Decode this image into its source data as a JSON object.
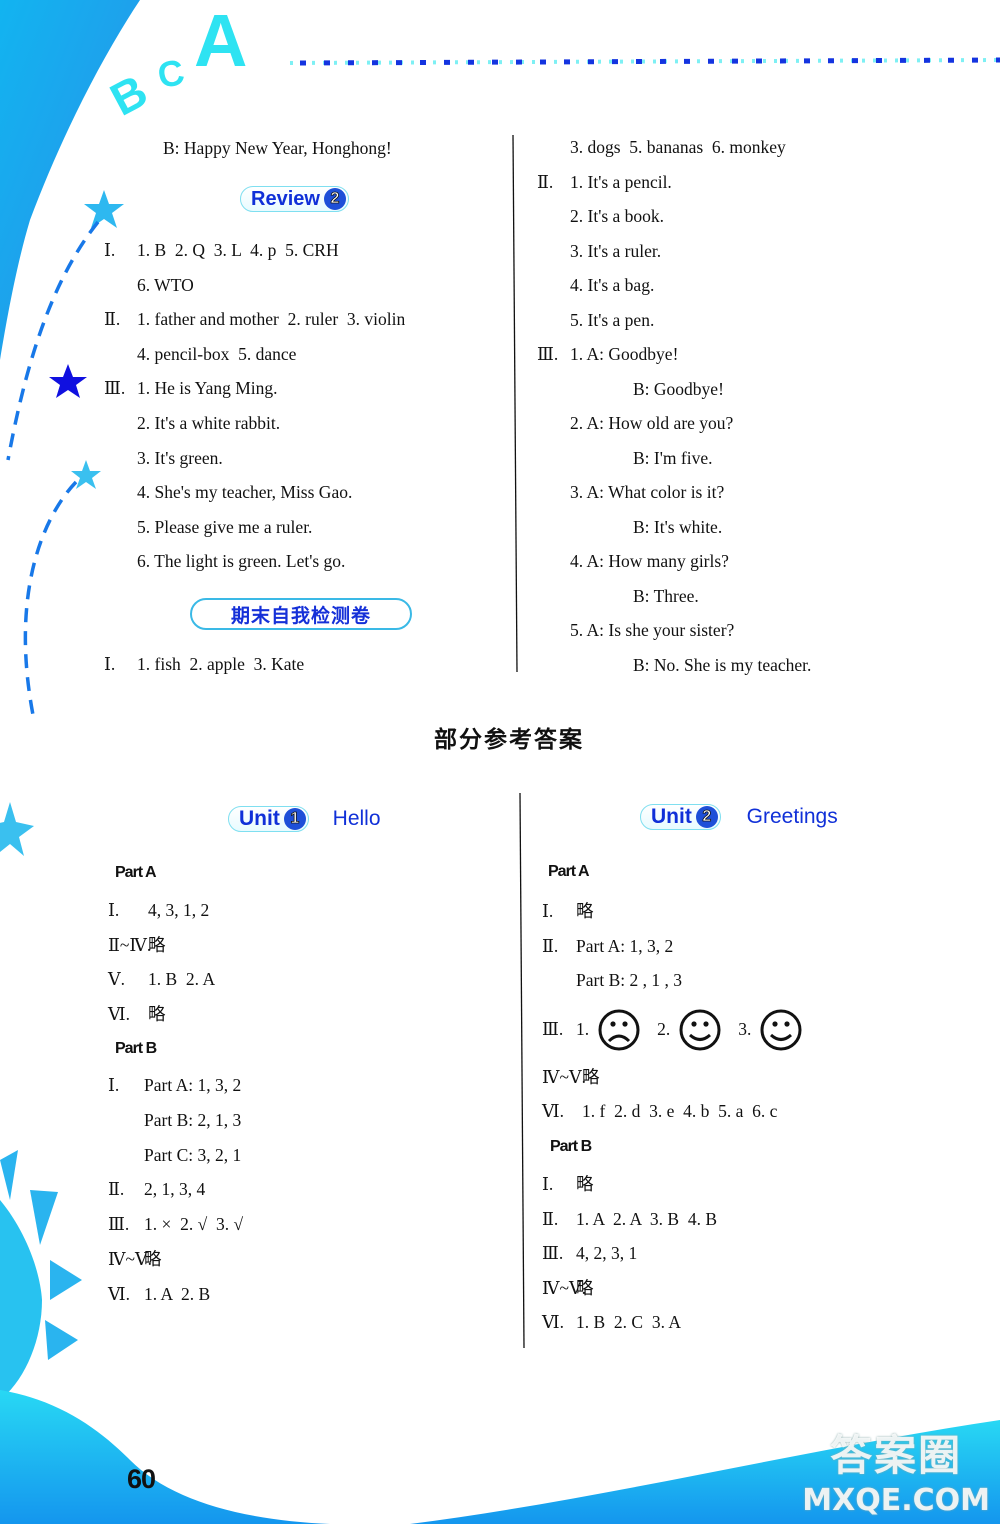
{
  "header": {
    "letters": [
      "B",
      "C",
      "A"
    ]
  },
  "left_column_top": {
    "continued_line": "B: Happy New Year, Honghong!",
    "review": {
      "label": "Review",
      "number": "2"
    },
    "lines": [
      {
        "roman": "Ⅰ.",
        "text": "1. B  2. Q  3. L  4. p  5. CRH"
      },
      {
        "roman": "",
        "text": "6. WTO"
      },
      {
        "roman": "Ⅱ.",
        "text": "1. father and mother  2. ruler  3. violin"
      },
      {
        "roman": "",
        "text": "4. pencil-box  5. dance"
      },
      {
        "roman": "Ⅲ.",
        "text": "1. He is Yang Ming."
      },
      {
        "roman": "",
        "text": "2. It's a white rabbit."
      },
      {
        "roman": "",
        "text": "3. It's green."
      },
      {
        "roman": "",
        "text": "4. She's my teacher, Miss Gao."
      },
      {
        "roman": "",
        "text": "5. Please give me a ruler."
      },
      {
        "roman": "",
        "text": "6. The light is green. Let's go."
      }
    ],
    "exam_title": "期末自我检测卷",
    "exam_lines": [
      {
        "roman": "Ⅰ.",
        "text": "1. fish  2. apple  3. Kate"
      }
    ]
  },
  "right_column_top": {
    "lines": [
      {
        "roman": "",
        "text": "3. dogs  5. bananas  6. monkey"
      },
      {
        "roman": "Ⅱ.",
        "text": "1. It's a pencil."
      },
      {
        "roman": "",
        "text": "2. It's a book."
      },
      {
        "roman": "",
        "text": "3. It's a ruler."
      },
      {
        "roman": "",
        "text": "4. It's a bag."
      },
      {
        "roman": "",
        "text": "5. It's a pen."
      },
      {
        "roman": "Ⅲ.",
        "text": "1. A: Goodbye!"
      },
      {
        "roman": "",
        "text": "B: Goodbye!"
      },
      {
        "roman": "",
        "text": "2. A: How old are you?"
      },
      {
        "roman": "",
        "text": "B: I'm five."
      },
      {
        "roman": "",
        "text": "3. A: What color is it?"
      },
      {
        "roman": "",
        "text": "B: It's white."
      },
      {
        "roman": "",
        "text": "4. A: How many girls?"
      },
      {
        "roman": "",
        "text": "B: Three."
      },
      {
        "roman": "",
        "text": "5. A: Is she your sister?"
      },
      {
        "roman": "",
        "text": "B: No. She is my teacher."
      }
    ]
  },
  "section_title": "部分参考答案",
  "unit1": {
    "label": "Unit",
    "number": "1",
    "title": "Hello",
    "part_a": {
      "tag": "Part A",
      "lines": [
        {
          "roman": "Ⅰ.",
          "text": "4, 3, 1, 2"
        },
        {
          "roman": "Ⅱ~Ⅳ.",
          "text": "略"
        },
        {
          "roman": "Ⅴ.",
          "text": "1. B  2. A"
        },
        {
          "roman": "Ⅵ.",
          "text": "略"
        }
      ]
    },
    "part_b": {
      "tag": "Part B",
      "lines": [
        {
          "roman": "Ⅰ.",
          "text": "Part A: 1, 3, 2"
        },
        {
          "roman": "",
          "text": "Part B: 2, 1, 3"
        },
        {
          "roman": "",
          "text": "Part C: 3, 2, 1"
        },
        {
          "roman": "Ⅱ.",
          "text": "2, 1, 3, 4"
        },
        {
          "roman": "Ⅲ.",
          "text": "1. ×  2. √  3. √"
        },
        {
          "roman": "Ⅳ~Ⅴ.",
          "text": "略"
        },
        {
          "roman": "Ⅵ.",
          "text": "1. A  2. B"
        }
      ]
    }
  },
  "unit2": {
    "label": "Unit",
    "number": "2",
    "title": "Greetings",
    "part_a": {
      "tag": "Part A",
      "lines": [
        {
          "roman": "Ⅰ.",
          "text": "略"
        },
        {
          "roman": "Ⅱ.",
          "text": "Part A: 1, 3, 2"
        },
        {
          "roman": "",
          "text": "Part B: 2 , 1 , 3"
        }
      ],
      "faces_roman": "Ⅲ.",
      "faces": [
        {
          "num": "1.",
          "mood": "sad"
        },
        {
          "num": "2.",
          "mood": "happy"
        },
        {
          "num": "3.",
          "mood": "happy"
        }
      ],
      "lines_after": [
        {
          "roman": "Ⅳ~Ⅴ.",
          "text": "略"
        },
        {
          "roman": "Ⅵ.",
          "text": "1. f  2. d  3. e  4. b  5. a  6. c"
        }
      ]
    },
    "part_b": {
      "tag": "Part B",
      "lines": [
        {
          "roman": "Ⅰ.",
          "text": "略"
        },
        {
          "roman": "Ⅱ.",
          "text": "1. A  2. A  3. B  4. B"
        },
        {
          "roman": "Ⅲ.",
          "text": "4, 2, 3, 1"
        },
        {
          "roman": "Ⅳ~Ⅴ.",
          "text": "略"
        },
        {
          "roman": "Ⅵ.",
          "text": "1. B  2. C  3. A"
        }
      ]
    }
  },
  "footer": {
    "page_number": "60",
    "watermark_cn": "答案圈",
    "watermark_en": "MXQE.COM"
  },
  "colors": {
    "brand_blue": "#1030d8",
    "cyan": "#2ee3f2",
    "sky": "#1aa8f0"
  }
}
